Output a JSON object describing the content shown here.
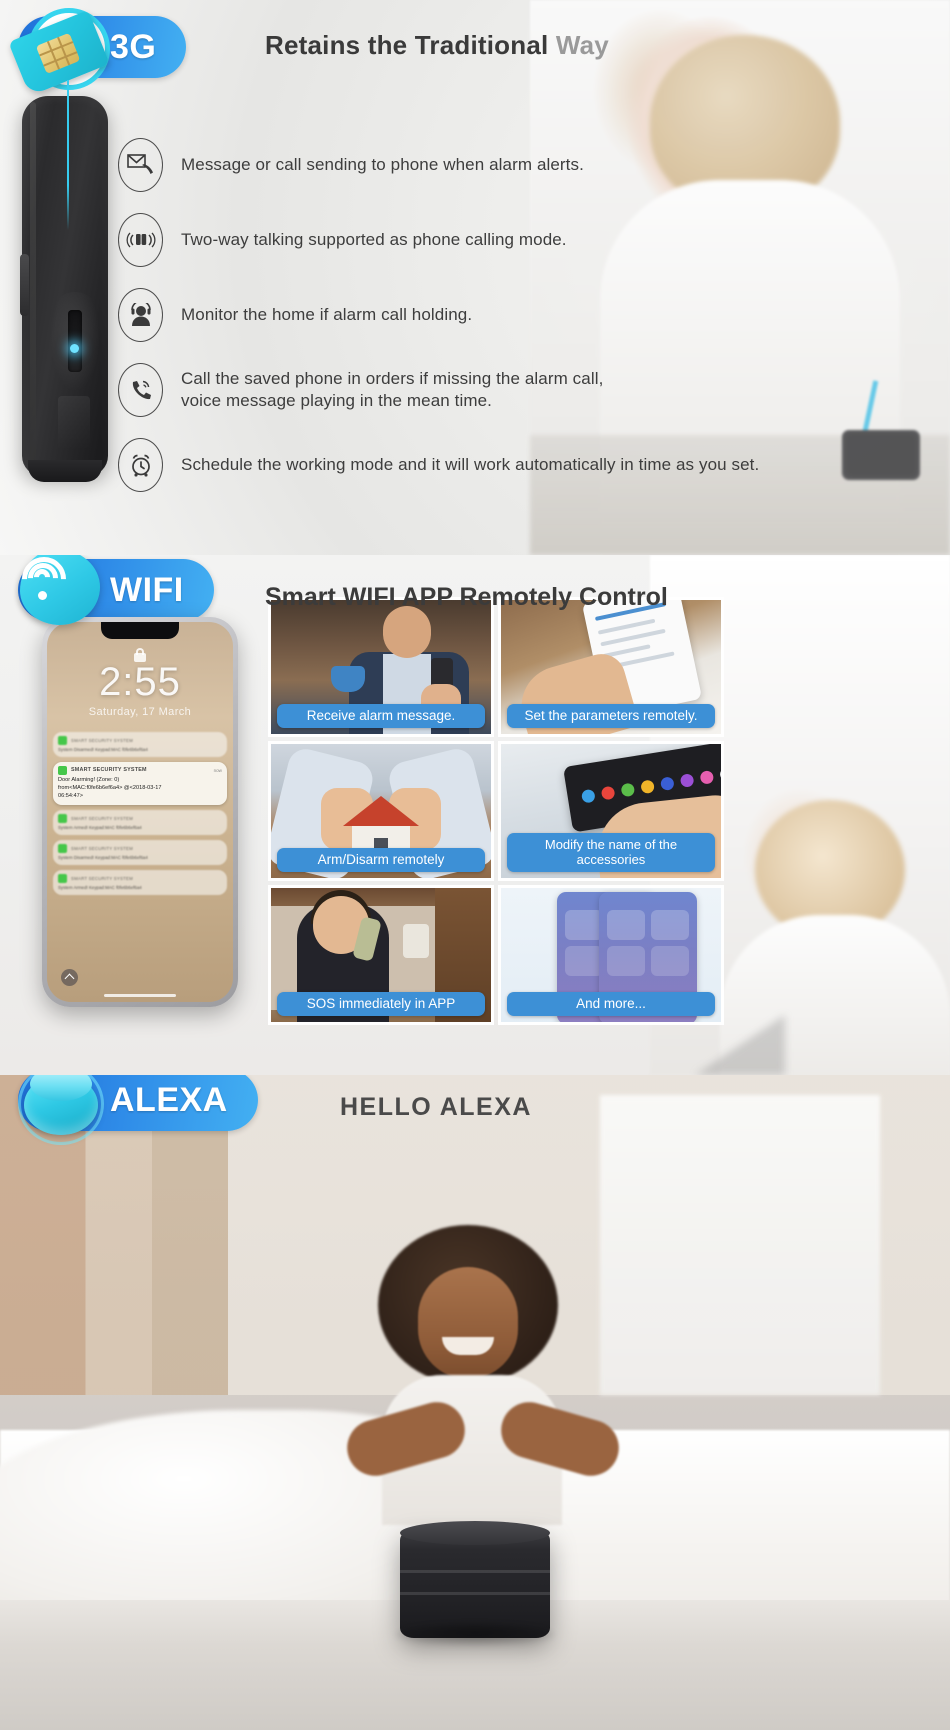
{
  "section_3g": {
    "badge_label": "3G",
    "badge_icon": "sim-card-icon",
    "heading_strong": "Retains the Traditional",
    "heading_dim": "Way",
    "features": [
      {
        "icon": "message-call-icon",
        "text": "Message or call sending to phone when alarm alerts."
      },
      {
        "icon": "two-way-talk-icon",
        "text": "Two-way talking supported as phone calling mode."
      },
      {
        "icon": "monitor-person-icon",
        "text": "Monitor the home if alarm call holding."
      },
      {
        "icon": "phone-ringing-icon",
        "text": "Call the saved phone in orders if missing the alarm call,\nvoice message playing in the mean time."
      },
      {
        "icon": "alarm-clock-icon",
        "text": "Schedule the working mode and it will work automatically in time as you set."
      }
    ]
  },
  "section_wifi": {
    "badge_label": "WIFI",
    "badge_icon": "wifi-signal-icon",
    "heading": "Smart WIFI APP Remotely Control",
    "phone": {
      "clock": "2:55",
      "date": "Saturday, 17 March",
      "active_notification": {
        "app": "SMART SECURITY SYSTEM",
        "time": "now",
        "line1": "Door Alarming! (Zone: 0)",
        "line2": "from<MAC:f0fe6b6ef6a4> @<2018-03-17",
        "line3": "06:54:47>"
      },
      "dim_notifications": [
        {
          "app": "SMART SECURITY SYSTEM",
          "body": "System Disarmed! Keypad:MAC f0fe6b6ef6a4"
        },
        {
          "app": "SMART SECURITY SYSTEM",
          "body": "System Armed! Keypad:MAC f0fe6b6ef6a4"
        },
        {
          "app": "SMART SECURITY SYSTEM",
          "body": "System Disarmed! Keypad:MAC f0fe6b6ef6a4"
        },
        {
          "app": "SMART SECURITY SYSTEM",
          "body": "System Armed! Keypad:MAC f0fe6b6ef6a4"
        }
      ]
    },
    "tiles": [
      {
        "caption": "Receive alarm message.",
        "art": "man-with-coffee-and-phone"
      },
      {
        "caption": "Set the parameters remotely.",
        "art": "hand-holding-phone-settings"
      },
      {
        "caption": "Arm/Disarm remotely",
        "art": "hands-protecting-house"
      },
      {
        "caption": "Modify the name of the accessories",
        "art": "hands-holding-tablet-app"
      },
      {
        "caption": "SOS immediately in APP",
        "art": "child-on-telephone"
      },
      {
        "caption": "And more...",
        "art": "two-phones-app-screens"
      }
    ]
  },
  "section_alexa": {
    "badge_label": "ALEXA",
    "badge_icon": "alexa-speaker-icon",
    "heading": "HELLO ALEXA"
  },
  "colors": {
    "badge_gradient_start": "#1f6fd8",
    "badge_gradient_end": "#43b0f2",
    "caption_blue": "#3d90d6",
    "accent_cyan": "#2ec8e4",
    "heading_dark": "#3a3a3a",
    "heading_dim": "#9a9a9a"
  }
}
